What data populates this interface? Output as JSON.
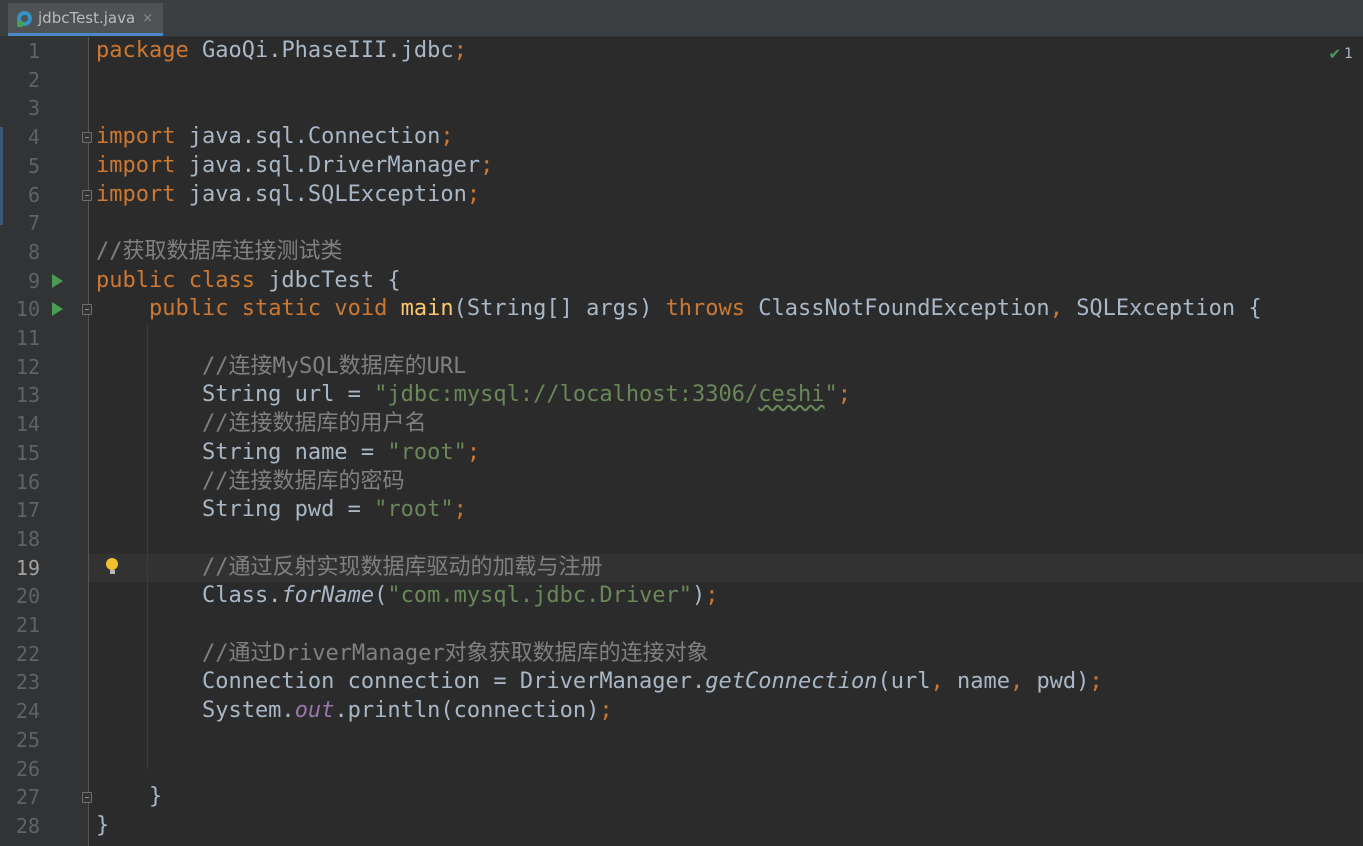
{
  "tab": {
    "icon": "java-class-icon",
    "filename": "jdbcTest.java",
    "close_glyph": "×"
  },
  "inspection": {
    "icon": "checkmark-icon",
    "count": "1"
  },
  "editor": {
    "current_line": 19,
    "lines": [
      {
        "num": "1",
        "parts": [
          [
            "kw",
            "package "
          ],
          [
            "",
            "GaoQi.PhaseIII.jdbc"
          ],
          [
            "kw",
            ";"
          ]
        ]
      },
      {
        "num": "2",
        "parts": []
      },
      {
        "num": "3",
        "parts": []
      },
      {
        "num": "4",
        "parts": [
          [
            "kw",
            "import "
          ],
          [
            "",
            "java.sql.Connection"
          ],
          [
            "kw",
            ";"
          ]
        ]
      },
      {
        "num": "5",
        "parts": [
          [
            "kw",
            "import "
          ],
          [
            "",
            "java.sql.DriverManager"
          ],
          [
            "kw",
            ";"
          ]
        ]
      },
      {
        "num": "6",
        "parts": [
          [
            "kw",
            "import "
          ],
          [
            "",
            "java.sql.SQLException"
          ],
          [
            "kw",
            ";"
          ]
        ]
      },
      {
        "num": "7",
        "parts": []
      },
      {
        "num": "8",
        "parts": [
          [
            "cm",
            "//获取数据库连接测试类"
          ]
        ]
      },
      {
        "num": "9",
        "parts": [
          [
            "kw",
            "public class "
          ],
          [
            "",
            "jdbcTest {"
          ]
        ]
      },
      {
        "num": "10",
        "parts": [
          [
            "",
            "    "
          ],
          [
            "kw",
            "public static void "
          ],
          [
            "fn",
            "main"
          ],
          [
            "",
            "(String[] args) "
          ],
          [
            "kw",
            "throws "
          ],
          [
            "",
            "ClassNotFoundException"
          ],
          [
            "kw",
            ", "
          ],
          [
            "",
            "SQLException {"
          ]
        ]
      },
      {
        "num": "11",
        "parts": []
      },
      {
        "num": "12",
        "parts": [
          [
            "",
            "        "
          ],
          [
            "cm",
            "//连接MySQL数据库的URL"
          ]
        ]
      },
      {
        "num": "13",
        "parts": [
          [
            "",
            "        String url = "
          ],
          [
            "str",
            "\"jdbc:mysql://localhost:3306/"
          ],
          [
            "str typo",
            "ceshi"
          ],
          [
            "str",
            "\""
          ],
          [
            "kw",
            ";"
          ]
        ]
      },
      {
        "num": "14",
        "parts": [
          [
            "",
            "        "
          ],
          [
            "cm",
            "//连接数据库的用户名"
          ]
        ]
      },
      {
        "num": "15",
        "parts": [
          [
            "",
            "        String name = "
          ],
          [
            "str",
            "\"root\""
          ],
          [
            "kw",
            ";"
          ]
        ]
      },
      {
        "num": "16",
        "parts": [
          [
            "",
            "        "
          ],
          [
            "cm",
            "//连接数据库的密码"
          ]
        ]
      },
      {
        "num": "17",
        "parts": [
          [
            "",
            "        String pwd = "
          ],
          [
            "str",
            "\"root\""
          ],
          [
            "kw",
            ";"
          ]
        ]
      },
      {
        "num": "18",
        "parts": []
      },
      {
        "num": "19",
        "parts": [
          [
            "",
            "        "
          ],
          [
            "cm",
            "//通过反射实现数据库驱动的加载与注册"
          ]
        ]
      },
      {
        "num": "20",
        "parts": [
          [
            "",
            "        Class."
          ],
          [
            "it",
            "forName"
          ],
          [
            "",
            "("
          ],
          [
            "str",
            "\"com.mysql.jdbc.Driver\""
          ],
          [
            "",
            ")"
          ],
          [
            "kw",
            ";"
          ]
        ]
      },
      {
        "num": "21",
        "parts": []
      },
      {
        "num": "22",
        "parts": [
          [
            "",
            "        "
          ],
          [
            "cm",
            "//通过DriverManager对象获取数据库的连接对象"
          ]
        ]
      },
      {
        "num": "23",
        "parts": [
          [
            "",
            "        Connection connection = DriverManager."
          ],
          [
            "it",
            "getConnection"
          ],
          [
            "",
            "(url"
          ],
          [
            "kw",
            ", "
          ],
          [
            "",
            "name"
          ],
          [
            "kw",
            ", "
          ],
          [
            "",
            "pwd)"
          ],
          [
            "kw",
            ";"
          ]
        ]
      },
      {
        "num": "24",
        "parts": [
          [
            "",
            "        System."
          ],
          [
            "static-field",
            "out"
          ],
          [
            "",
            ".println(connection)"
          ],
          [
            "kw",
            ";"
          ]
        ]
      },
      {
        "num": "25",
        "parts": []
      },
      {
        "num": "26",
        "parts": []
      },
      {
        "num": "27",
        "parts": [
          [
            "",
            "    }"
          ]
        ]
      },
      {
        "num": "28",
        "parts": [
          [
            "",
            "}"
          ]
        ]
      }
    ],
    "run_lines": [
      9,
      10
    ],
    "fold_lines": [
      4,
      6,
      10,
      27
    ],
    "bulb_line": 19,
    "bulb_icon": "intention-bulb-icon",
    "run_icon": "run-gutter-icon",
    "fold_icon": "fold-marker-icon"
  }
}
